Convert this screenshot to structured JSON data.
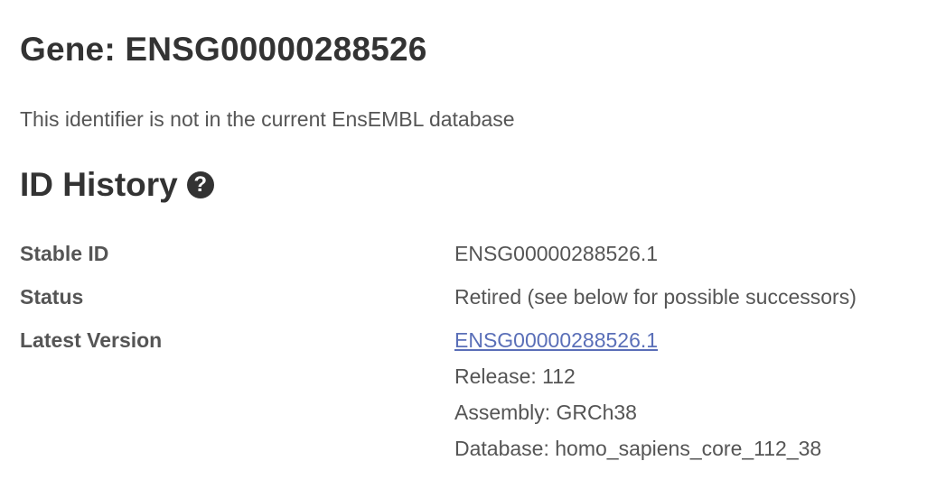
{
  "page": {
    "title": "Gene: ENSG00000288526",
    "notice": "This identifier is not in the current EnsEMBL database"
  },
  "id_history": {
    "heading": "ID History",
    "help_icon_glyph": "?",
    "help_icon": "question-circle-icon",
    "rows": {
      "stable_id": {
        "label": "Stable ID",
        "value": "ENSG00000288526.1"
      },
      "status": {
        "label": "Status",
        "value": "Retired (see below for possible successors)"
      },
      "latest_version": {
        "label": "Latest Version",
        "link": "ENSG00000288526.1",
        "release": "Release: 112",
        "assembly": "Assembly: GRCh38",
        "database": "Database: homo_sapiens_core_112_38"
      }
    }
  },
  "colors": {
    "text": "#333333",
    "muted_text": "#555555",
    "link": "#5a6fb8"
  }
}
